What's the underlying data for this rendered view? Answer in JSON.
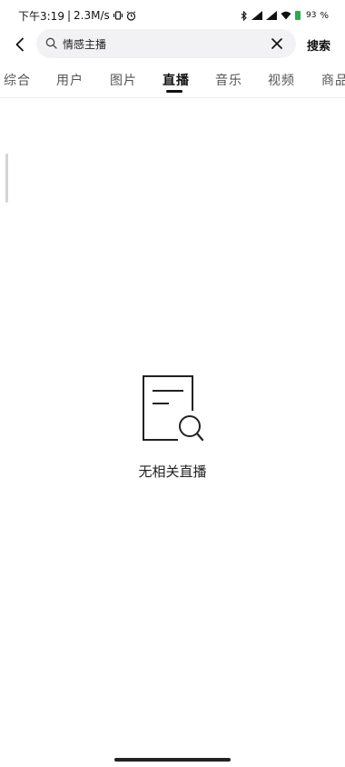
{
  "status_bar": {
    "time": "下午3:19",
    "separator": "|",
    "network_speed": "2.3M/s",
    "battery_level": "93",
    "right_extra": "%"
  },
  "search": {
    "query": "情感主播",
    "submit_label": "搜索"
  },
  "tabs": [
    {
      "label": "综合",
      "active": false
    },
    {
      "label": "用户",
      "active": false
    },
    {
      "label": "图片",
      "active": false
    },
    {
      "label": "直播",
      "active": true
    },
    {
      "label": "音乐",
      "active": false
    },
    {
      "label": "视频",
      "active": false
    },
    {
      "label": "商品",
      "active": false
    }
  ],
  "empty_state": {
    "message": "无相关直播",
    "icon": "document-search-icon"
  },
  "colors": {
    "accent": "#111111",
    "search_bg": "#f2f2f5",
    "battery": "#2ea84f"
  }
}
